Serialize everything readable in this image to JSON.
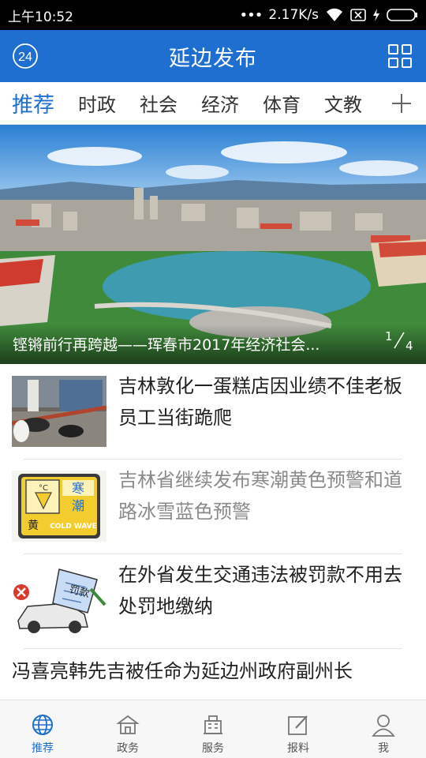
{
  "status_bar": {
    "time": "上午10:52",
    "network_speed": "2.17K/s"
  },
  "header": {
    "logo_text": "24",
    "title": "延边发布",
    "accent_color": "#1e6fcf"
  },
  "tabs": [
    {
      "label": "推荐",
      "active": true
    },
    {
      "label": "时政",
      "active": false
    },
    {
      "label": "社会",
      "active": false
    },
    {
      "label": "经济",
      "active": false
    },
    {
      "label": "体育",
      "active": false
    },
    {
      "label": "文教",
      "active": false
    }
  ],
  "carousel": {
    "caption": "铿锵前行再跨越——珲春市2017年经济社会...",
    "current": "1",
    "total": "4"
  },
  "news": [
    {
      "headline": "吉林敦化一蛋糕店因业绩不佳老板员工当街跪爬",
      "read": false,
      "thumb_icon": "street-photo-icon"
    },
    {
      "headline": "吉林省继续发布寒潮黄色预警和道路冰雪蓝色预警",
      "read": true,
      "thumb_icon": "cold-wave-warning-icon",
      "thumb_text": {
        "top": "寒",
        "middle": "潮",
        "bottom": "黄",
        "english": "COLD WAVE",
        "unit": "°C"
      }
    },
    {
      "headline": "在外省发生交通违法被罚款不用去处罚地缴纳",
      "read": false,
      "thumb_icon": "traffic-fine-cartoon-icon",
      "thumb_text": {
        "ticket": "罚款"
      }
    },
    {
      "headline": "冯喜亮韩先吉被任命为延边州政府副州长",
      "read": false
    }
  ],
  "bottom_nav": [
    {
      "label": "推荐",
      "icon": "globe-icon",
      "active": true
    },
    {
      "label": "政务",
      "icon": "government-building-icon",
      "active": false
    },
    {
      "label": "服务",
      "icon": "city-buildings-icon",
      "active": false
    },
    {
      "label": "报料",
      "icon": "edit-icon",
      "active": false
    },
    {
      "label": "我",
      "icon": "user-icon",
      "active": false
    }
  ]
}
